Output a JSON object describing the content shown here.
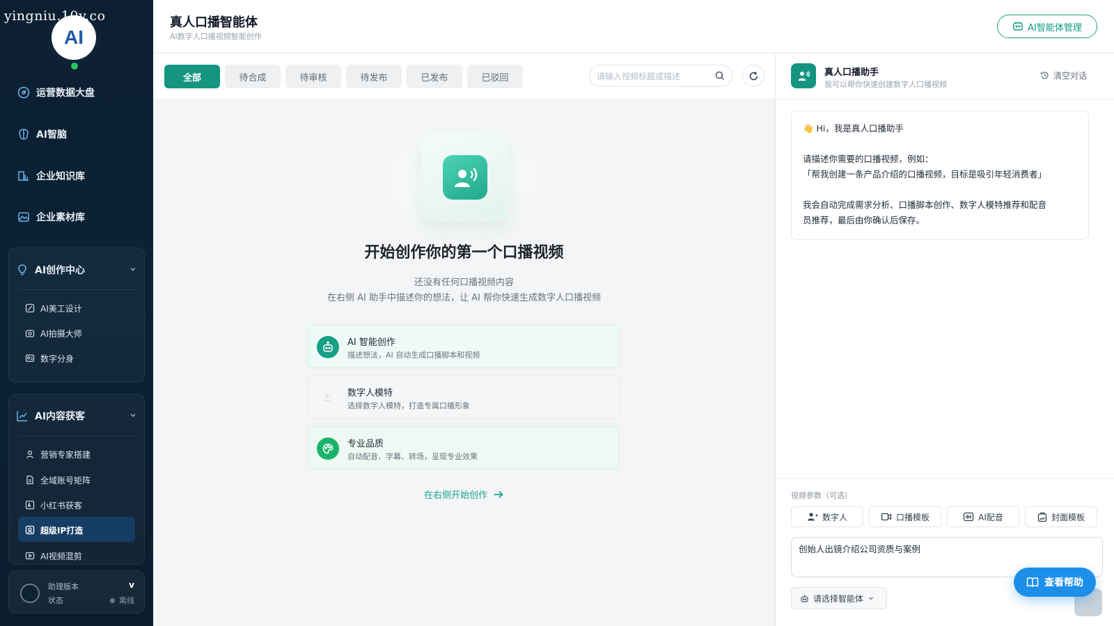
{
  "watermark": "yingniu.10v.co",
  "logo": {
    "text": "AI"
  },
  "sidebar": {
    "nav": [
      {
        "label": "运营数据大盘",
        "icon": "dashboard-icon"
      },
      {
        "label": "AI智脑",
        "icon": "brain-icon"
      },
      {
        "label": "企业知识库",
        "icon": "knowledge-base-icon"
      },
      {
        "label": "企业素材库",
        "icon": "image-library-icon"
      }
    ],
    "groups": [
      {
        "label": "AI创作中心",
        "icon": "lightbulb-icon",
        "items": [
          {
            "label": "AI美工设计",
            "icon": "design-icon"
          },
          {
            "label": "AI拍摄大师",
            "icon": "camera-icon"
          },
          {
            "label": "数字分身",
            "icon": "id-card-icon"
          }
        ]
      },
      {
        "label": "AI内容获客",
        "icon": "trend-chart-icon",
        "items": [
          {
            "label": "营销专家搭建",
            "icon": "user-icon"
          },
          {
            "label": "全域账号矩阵",
            "icon": "document-icon"
          },
          {
            "label": "小红书获客",
            "icon": "xiaohongshu-icon"
          },
          {
            "label": "超级IP打造",
            "icon": "ip-badge-icon",
            "active": true
          },
          {
            "label": "AI视频混剪",
            "icon": "video-icon"
          }
        ]
      }
    ],
    "footer": {
      "version_label": "助理版本",
      "version_value": "v",
      "status_label": "状态",
      "status_value": "离线"
    }
  },
  "header": {
    "title": "真人口播智能体",
    "subtitle": "AI数字人口播视频智能创作",
    "manage_button": "AI智能体管理"
  },
  "tabs": [
    {
      "label": "全部",
      "active": true
    },
    {
      "label": "待合成"
    },
    {
      "label": "待审核"
    },
    {
      "label": "待发布"
    },
    {
      "label": "已发布"
    },
    {
      "label": "已驳回"
    }
  ],
  "search": {
    "placeholder": "请输入视频标题或描述",
    "value": ""
  },
  "empty_state": {
    "title": "开始创作你的第一个口播视频",
    "line1": "还没有任何口播视频内容",
    "line2": "在右侧 AI 助手中描述你的想法，让 AI 帮你快速生成数字人口播视频",
    "features": [
      {
        "title": "AI 智能创作",
        "desc": "描述想法，AI 自动生成口播脚本和视频",
        "icon": "robot-icon"
      },
      {
        "title": "数字人模特",
        "desc": "选择数字人模特，打造专属口播形象",
        "icon": "person-icon"
      },
      {
        "title": "专业品质",
        "desc": "自动配音、字幕、转场，呈现专业效果",
        "icon": "palette-icon"
      }
    ],
    "start_link": "在右侧开始创作"
  },
  "assistant": {
    "name": "真人口播助手",
    "desc": "我可以帮你快速创建数字人口播视频",
    "clear_label": "清空对话",
    "message": {
      "greeting": "👋 Hi，我是真人口播助手",
      "line1": "请描述你需要的口播视频，例如：",
      "line2": "「帮我创建一条产品介绍的口播视频，目标是吸引年轻消费者」",
      "line3": "我会自动完成需求分析、口播脚本创作、数字人模特推荐和配音",
      "line4": "员推荐，最后由你确认后保存。"
    },
    "params_label": "视频参数（可选）",
    "params": [
      {
        "label": "数字人",
        "icon": "user-add-icon"
      },
      {
        "label": "口播模板",
        "icon": "video-template-icon"
      },
      {
        "label": "AI配音",
        "icon": "audio-wave-icon"
      },
      {
        "label": "封面模板",
        "icon": "cover-template-icon"
      }
    ],
    "composer_value": "创始人出镜介绍公司资质与案例",
    "agent_select": "请选择智能体",
    "help_button": "查看帮助"
  },
  "colors": {
    "primary": "#15957f",
    "sidebar_bg": "#0c1f30",
    "help_blue": "#1d8fe8"
  }
}
